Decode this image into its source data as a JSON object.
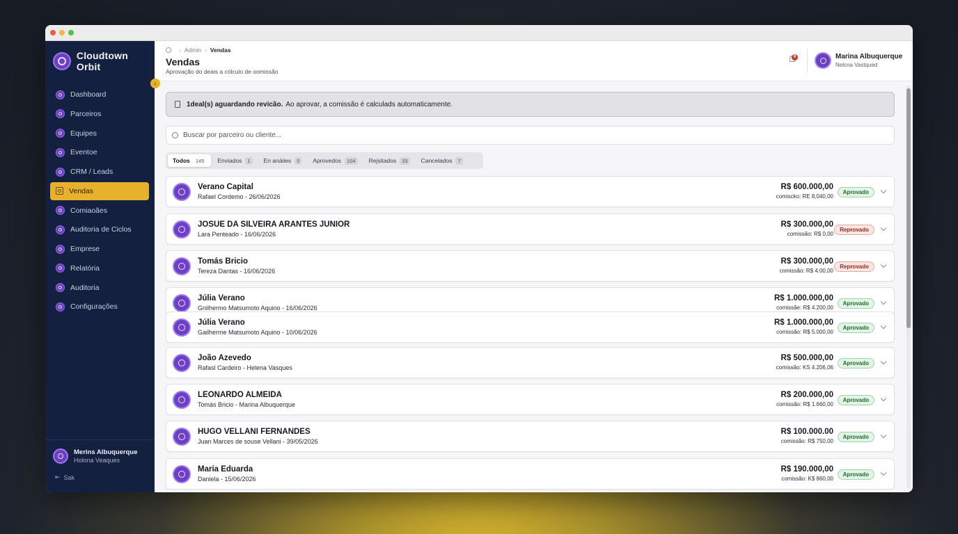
{
  "brand": {
    "name": "Cloudtown Orbit"
  },
  "sidebar": {
    "items": [
      {
        "label": "Dashboard",
        "icon": "dashboard-icon"
      },
      {
        "label": "Parceiros",
        "icon": "partners-icon"
      },
      {
        "label": "Equipes",
        "icon": "teams-icon"
      },
      {
        "label": "Eventoe",
        "icon": "events-icon"
      },
      {
        "label": "CRM / Leads",
        "icon": "crm-icon"
      },
      {
        "label": "Vendas",
        "icon": "sales-icon",
        "active": true
      },
      {
        "label": "Comiaoães",
        "icon": "commissions-icon"
      },
      {
        "label": "Auditoria de Ciclos",
        "icon": "cycle-audit-icon"
      },
      {
        "label": "Emprese",
        "icon": "company-icon"
      },
      {
        "label": "Relatória",
        "icon": "reports-icon"
      },
      {
        "label": "Auditoria",
        "icon": "audit-icon"
      },
      {
        "label": "Configurações",
        "icon": "settings-icon"
      }
    ],
    "user": {
      "name": "Merins Albuquerque",
      "org": "Holona Veaques"
    },
    "logout": "Sak"
  },
  "header": {
    "breadcrumb": {
      "parent": "Admin",
      "current": "Vendas"
    },
    "title": "Vendas",
    "subtitle": "Aprovação do deais a cólculo de oomissão",
    "notifications": "9",
    "user": {
      "name": "Marina Albuquerque",
      "org": "Nelcna Vastqued"
    }
  },
  "notice": {
    "strong": "1deal(s) aguardando revicão.",
    "text": "Ao aprovar, a comissão é calculads automaticamente."
  },
  "search": {
    "placeholder": "Buscar por parceiro ou cliente..."
  },
  "tabs": [
    {
      "label": "Todos",
      "count": "145",
      "active": true
    },
    {
      "label": "Enviados",
      "count": "1"
    },
    {
      "label": "En anáiies",
      "count": "0"
    },
    {
      "label": "Aprovedos",
      "count": "104"
    },
    {
      "label": "Rejsitados",
      "count": "33"
    },
    {
      "label": "Cancelados",
      "count": "7"
    }
  ],
  "deals": [
    {
      "name": "Verano Capital",
      "sub": "Rafael Cordemo - 26/06/2026",
      "amount": "R$ 600.000,00",
      "commission": "comiscko: RE 8,040,00",
      "status": "Aprovado",
      "status_type": "ok"
    },
    {
      "name": "JOSUE DA SILVEIRA ARANTES JUNIOR",
      "sub": "Lara Penteado - 16/06/2026",
      "amount": "R$ 300.000,00",
      "commission": "comissão: R$ 0,00",
      "status": "Reprovado",
      "status_type": "bad"
    },
    {
      "name": "Tomás Bricio",
      "sub": "Tereza Dantas - 16/06/2026",
      "amount": "R$ 300.000,00",
      "commission": "comissão: R$ 4.00,00",
      "status": "Reprovado",
      "status_type": "bad"
    },
    {
      "name": "Júlia Verano",
      "sub": "Gnilhermo Matsumoto Aquino - 16/06/2026",
      "amount": "R$ 1.000.000,00",
      "commission": "comissãe: R$ 4.200,00",
      "status": "Aprovado",
      "status_type": "ok"
    },
    {
      "name": "Júlia Verano",
      "sub": "Gailherme Matsumoto Aquino - 10/06/2026",
      "amount": "R$ 1.000.000,00",
      "commission": "comissão: R$ 5.000,00",
      "status": "Aprovado",
      "status_type": "ok"
    },
    {
      "name": "João Azevedo",
      "sub": "Rafasl Cardeiro - Helena Vasques",
      "amount": "R$ 500.000,00",
      "commission": "comissão: KS 4.206,06",
      "status": "Aprovado",
      "status_type": "ok"
    },
    {
      "name": "LEONARDO ALMEIDA",
      "sub": "Tomás Bricio - Marina Albuquerque",
      "amount": "R$ 200.000,00",
      "commission": "comissão: R$ 1.660,00",
      "status": "Aprovado",
      "status_type": "ok"
    },
    {
      "name": "HUGO VELLANI FERNANDES",
      "sub": "Juan Marces de souse Vellani - 39/05/2026",
      "amount": "R$ 100.000.00",
      "commission": "comissão: R$ 750,00",
      "status": "Aprovado",
      "status_type": "ok"
    },
    {
      "name": "Maria Eduarda",
      "sub": "Daniela - 15/06/2026",
      "amount": "R$ 190.000,00",
      "commission": "comissão: K$ 860,00",
      "status": "Aprovado",
      "status_type": "ok"
    }
  ]
}
